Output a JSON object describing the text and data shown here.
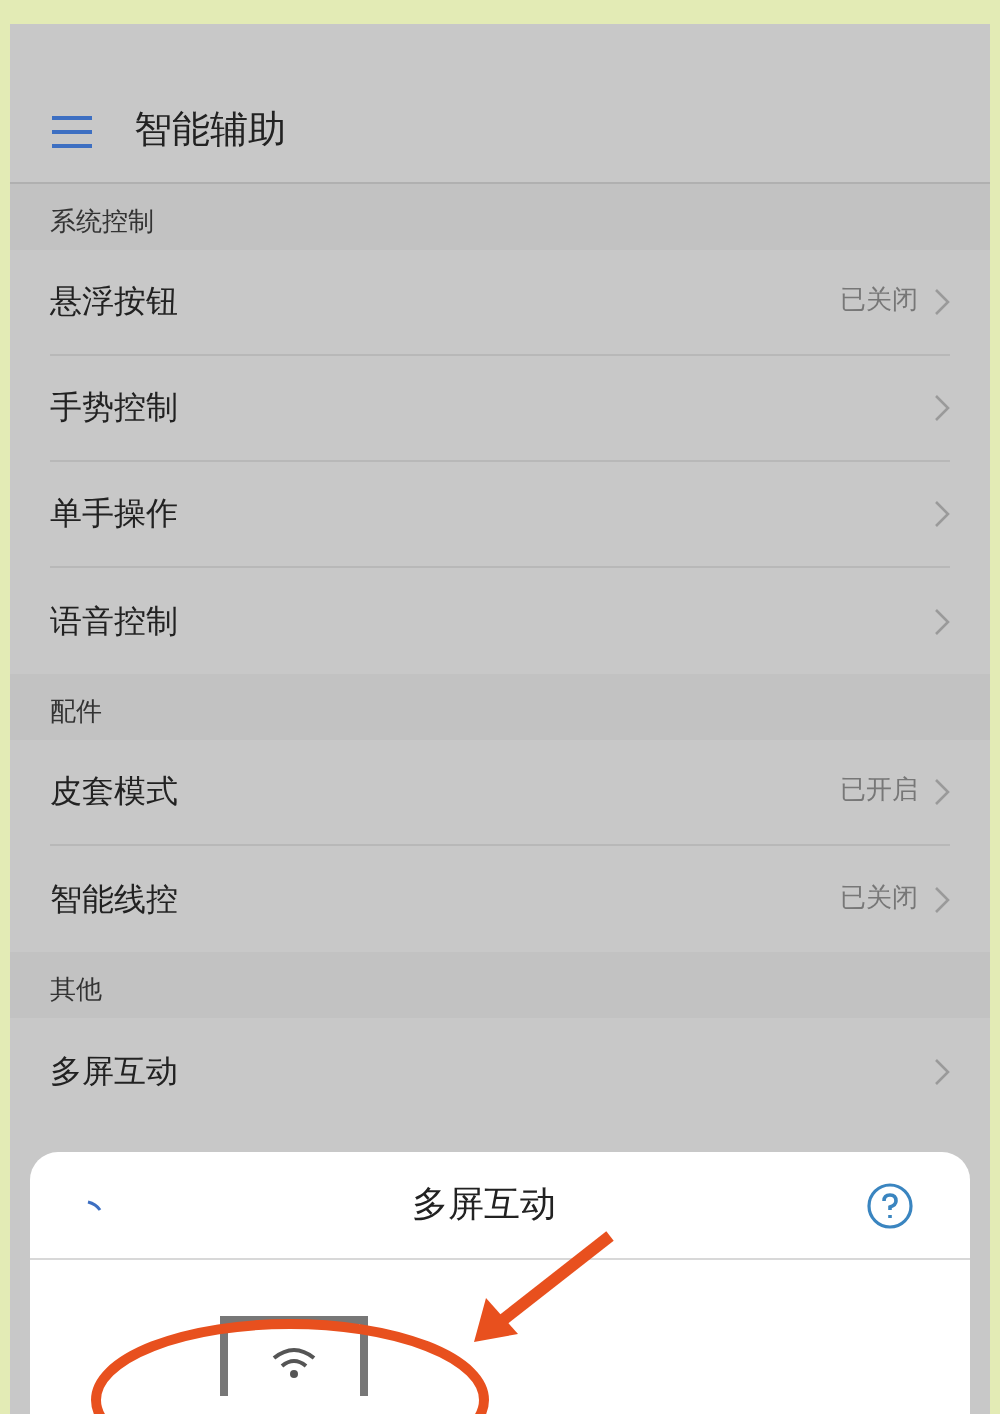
{
  "header": {
    "title": "智能辅助"
  },
  "sections": [
    {
      "title": "系统控制",
      "items": [
        {
          "label": "悬浮按钮",
          "value": "已关闭"
        },
        {
          "label": "手势控制"
        },
        {
          "label": "单手操作"
        },
        {
          "label": "语音控制"
        }
      ]
    },
    {
      "title": "配件",
      "items": [
        {
          "label": "皮套模式",
          "value": "已开启"
        },
        {
          "label": "智能线控",
          "value": "已关闭"
        }
      ]
    },
    {
      "title": "其他",
      "items": [
        {
          "label": "多屏互动"
        }
      ]
    }
  ],
  "sheet": {
    "title": "多屏互动"
  }
}
